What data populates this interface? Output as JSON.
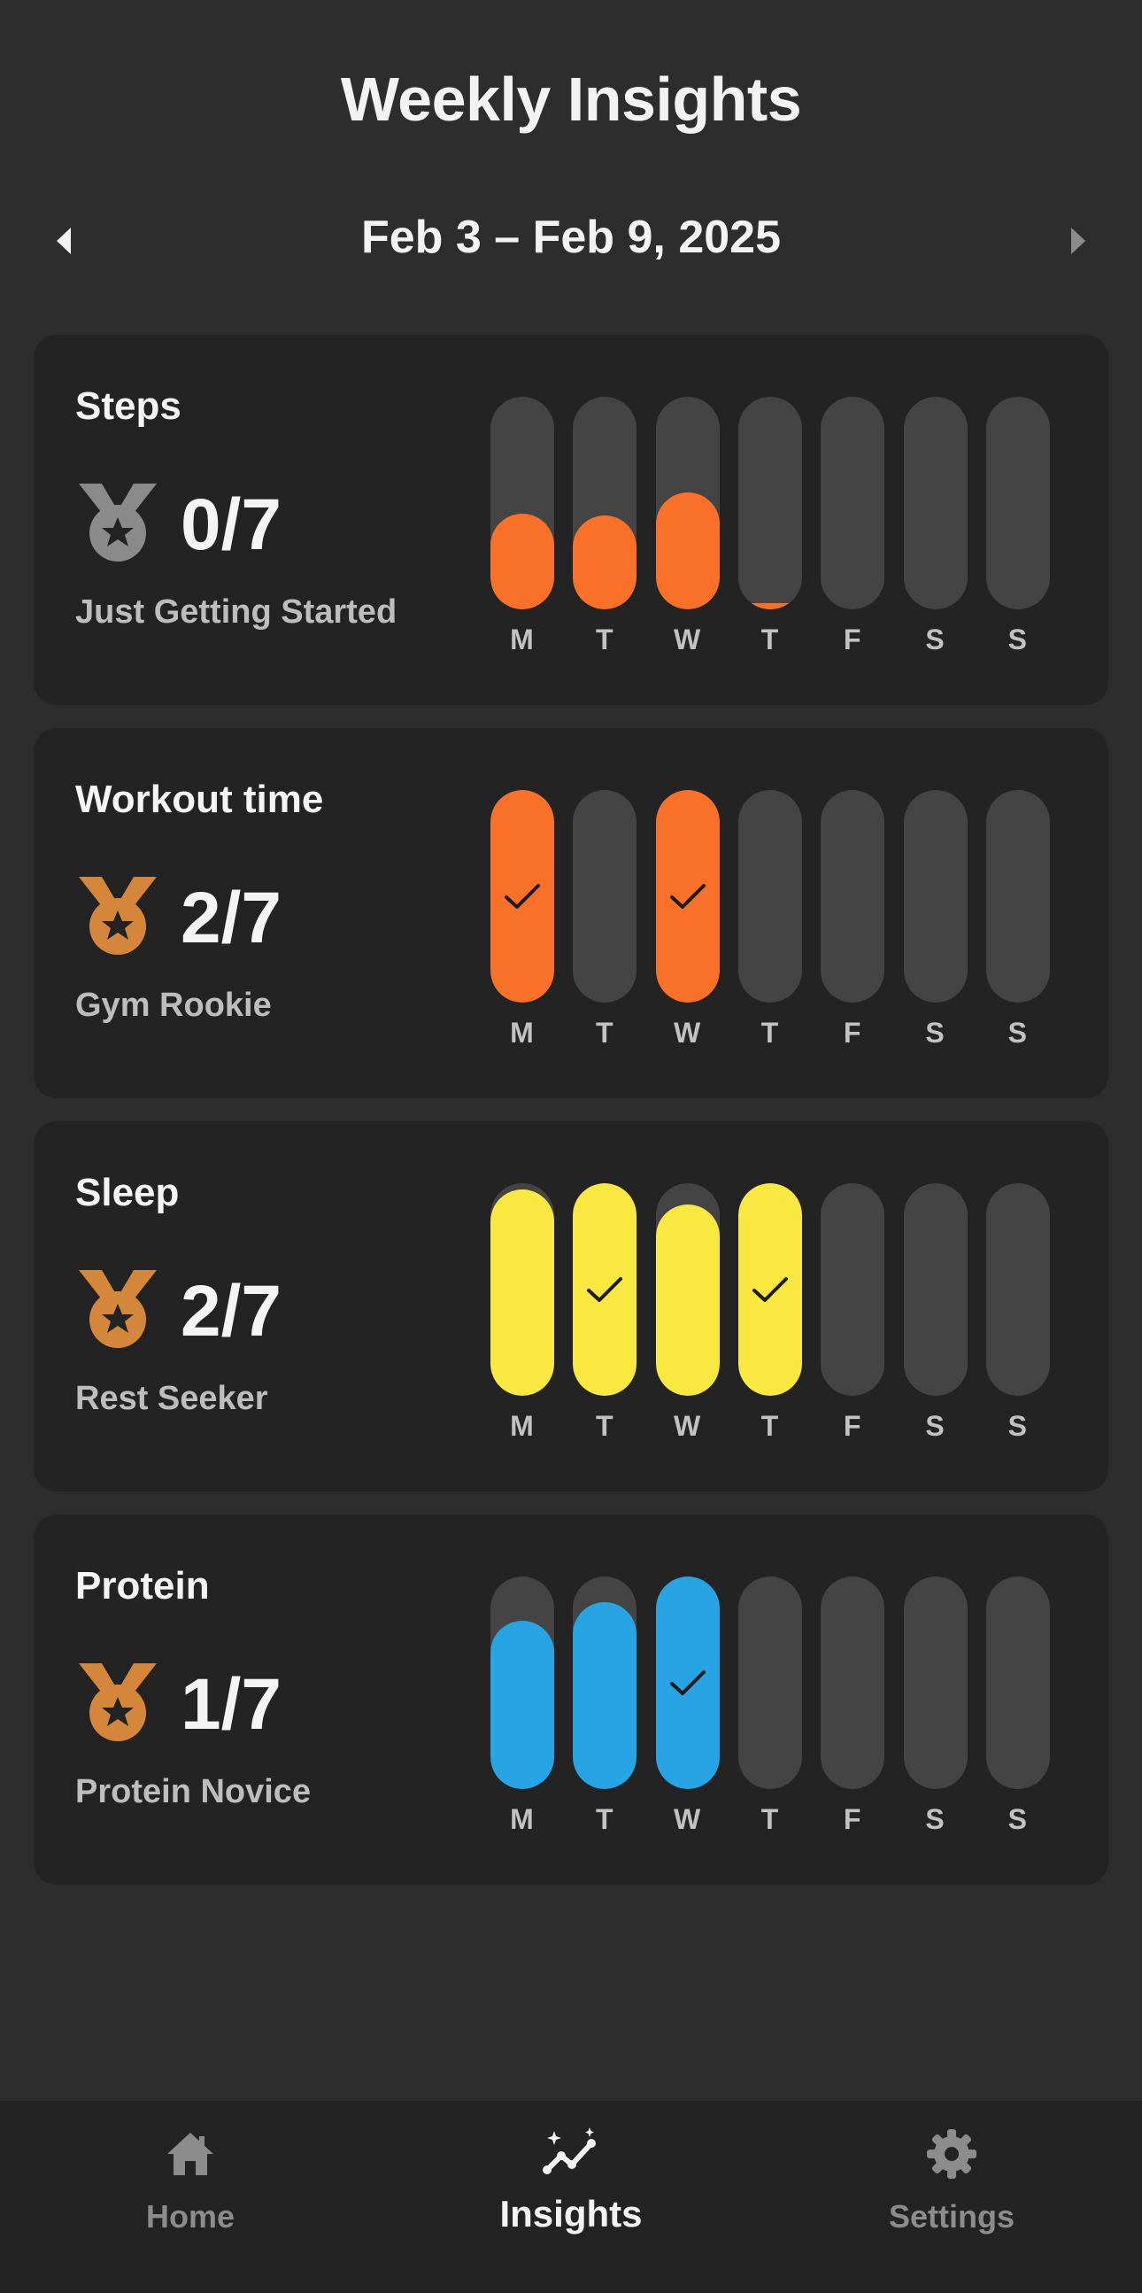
{
  "header": {
    "title": "Weekly Insights",
    "week_range": "Feb 3 – Feb 9, 2025",
    "prev_icon": "chevron-left-icon",
    "next_icon": "chevron-right-icon"
  },
  "colors": {
    "steps": "#f97128",
    "workout": "#f97128",
    "sleep": "#f9e83f",
    "protein": "#27a4e3",
    "track": "#444444",
    "medal_silver": "#8a8a8a",
    "medal_bronze": "#d4873a"
  },
  "cards": [
    {
      "title": "Steps",
      "score": "0/7",
      "badge": "Just Getting Started",
      "medal": "silver-medal-icon",
      "days": [
        "M",
        "T",
        "W",
        "T",
        "F",
        "S",
        "S"
      ],
      "progress": [
        0.45,
        0.44,
        0.55,
        0.03,
        0,
        0,
        0
      ],
      "achieved": [
        false,
        false,
        false,
        false,
        false,
        false,
        false
      ]
    },
    {
      "title": "Workout time",
      "score": "2/7",
      "badge": "Gym Rookie",
      "medal": "bronze-medal-icon",
      "days": [
        "M",
        "T",
        "W",
        "T",
        "F",
        "S",
        "S"
      ],
      "progress": [
        1,
        0,
        1,
        0,
        0,
        0,
        0
      ],
      "achieved": [
        true,
        false,
        true,
        false,
        false,
        false,
        false
      ]
    },
    {
      "title": "Sleep",
      "score": "2/7",
      "badge": "Rest Seeker",
      "medal": "bronze-medal-icon",
      "days": [
        "M",
        "T",
        "W",
        "T",
        "F",
        "S",
        "S"
      ],
      "progress": [
        0.97,
        1,
        0.9,
        1,
        0,
        0,
        0
      ],
      "achieved": [
        false,
        true,
        false,
        true,
        false,
        false,
        false
      ]
    },
    {
      "title": "Protein",
      "score": "1/7",
      "badge": "Protein Novice",
      "medal": "bronze-medal-icon",
      "days": [
        "M",
        "T",
        "W",
        "T",
        "F",
        "S",
        "S"
      ],
      "progress": [
        0.79,
        0.88,
        1,
        0,
        0,
        0,
        0
      ],
      "achieved": [
        false,
        false,
        true,
        false,
        false,
        false,
        false
      ]
    }
  ],
  "tabbar": {
    "home": "Home",
    "insights": "Insights",
    "settings": "Settings",
    "active": "insights"
  }
}
